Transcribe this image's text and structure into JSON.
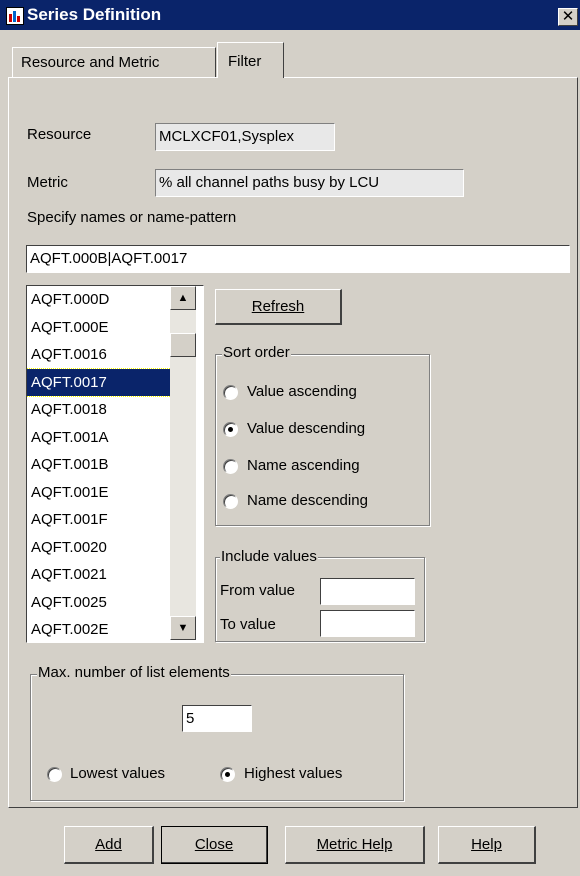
{
  "window": {
    "title": "Series Definition",
    "close_symbol": "✕"
  },
  "tabs": [
    {
      "label": "Resource and Metric",
      "active": false
    },
    {
      "label": "Filter",
      "active": true
    }
  ],
  "filter": {
    "resource_label": "Resource",
    "resource_value": "MCLXCF01,Sysplex",
    "metric_label": "Metric",
    "metric_value": "% all channel paths busy by LCU",
    "names_label": "Specify names or name-pattern",
    "names_value": "AQFT.000B|AQFT.0017",
    "list_items": [
      "AQFT.000D",
      "AQFT.000E",
      "AQFT.0016",
      "AQFT.0017",
      "AQFT.0018",
      "AQFT.001A",
      "AQFT.001B",
      "AQFT.001E",
      "AQFT.001F",
      "AQFT.0020",
      "AQFT.0021",
      "AQFT.0025",
      "AQFT.002E"
    ],
    "selected_item": "AQFT.0017",
    "refresh_label": "Refresh",
    "sort_order": {
      "legend": "Sort order",
      "options": [
        "Value ascending",
        "Value descending",
        "Name ascending",
        "Name descending"
      ],
      "selected": "Value descending"
    },
    "include_values": {
      "legend": "Include values",
      "from_label": "From value",
      "from_value": "",
      "to_label": "To value",
      "to_value": ""
    },
    "max_list": {
      "legend": "Max. number of list elements",
      "value": "5",
      "options": [
        "Lowest values",
        "Highest values"
      ],
      "selected": "Highest values"
    }
  },
  "footer": {
    "add_label": "Add",
    "close_label": "Close",
    "metric_help_label": "Metric Help",
    "help_label": "Help"
  },
  "colors": {
    "titlebar": "#0a246a",
    "dialog": "#d4d0c8",
    "selection": "#0a246a"
  }
}
